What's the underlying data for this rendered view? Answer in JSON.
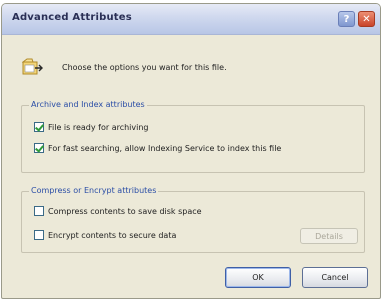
{
  "window": {
    "title": "Advanced Attributes",
    "help_button": "?",
    "close_button": "✕"
  },
  "intro": {
    "text": "Choose the options you want for this file.",
    "icon": "folder-options-icon"
  },
  "archive_group": {
    "label": "Archive and Index attributes",
    "items": [
      {
        "label": "File is ready for archiving",
        "checked": true
      },
      {
        "label": "For fast searching, allow Indexing Service to index this file",
        "checked": true
      }
    ]
  },
  "compress_group": {
    "label": "Compress or Encrypt attributes",
    "items": [
      {
        "label": "Compress contents to save disk space",
        "checked": false
      },
      {
        "label": "Encrypt contents to secure data",
        "checked": false
      }
    ],
    "details_button": "Details"
  },
  "buttons": {
    "ok": "OK",
    "cancel": "Cancel"
  },
  "colors": {
    "dialog_bg": "#ece9d8",
    "group_label": "#2b4ea6",
    "check": "#2f9a3a"
  }
}
